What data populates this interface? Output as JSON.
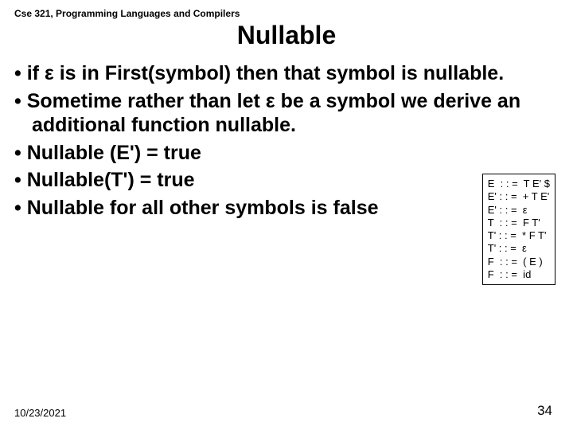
{
  "header": {
    "course": "Cse 321, Programming Languages and Compilers",
    "title": "Nullable"
  },
  "bullets_a": [
    "if ε is in First(symbol) then that symbol is nullable.",
    "Sometime rather than let ε be a symbol we derive an additional function nullable."
  ],
  "bullets_b": [
    "Nullable (E') = true",
    "Nullable(T') = true",
    "Nullable for all other symbols is false"
  ],
  "grammar": "E  : : =  T E' $\nE' : : =  + T E'\nE' : : =  ε\nT  : : =  F T'\nT' : : =  * F T'\nT' : : =  ε\nF  : : =  ( E )\nF  : : =  id",
  "footer": {
    "date": "10/23/2021",
    "page": "34"
  }
}
